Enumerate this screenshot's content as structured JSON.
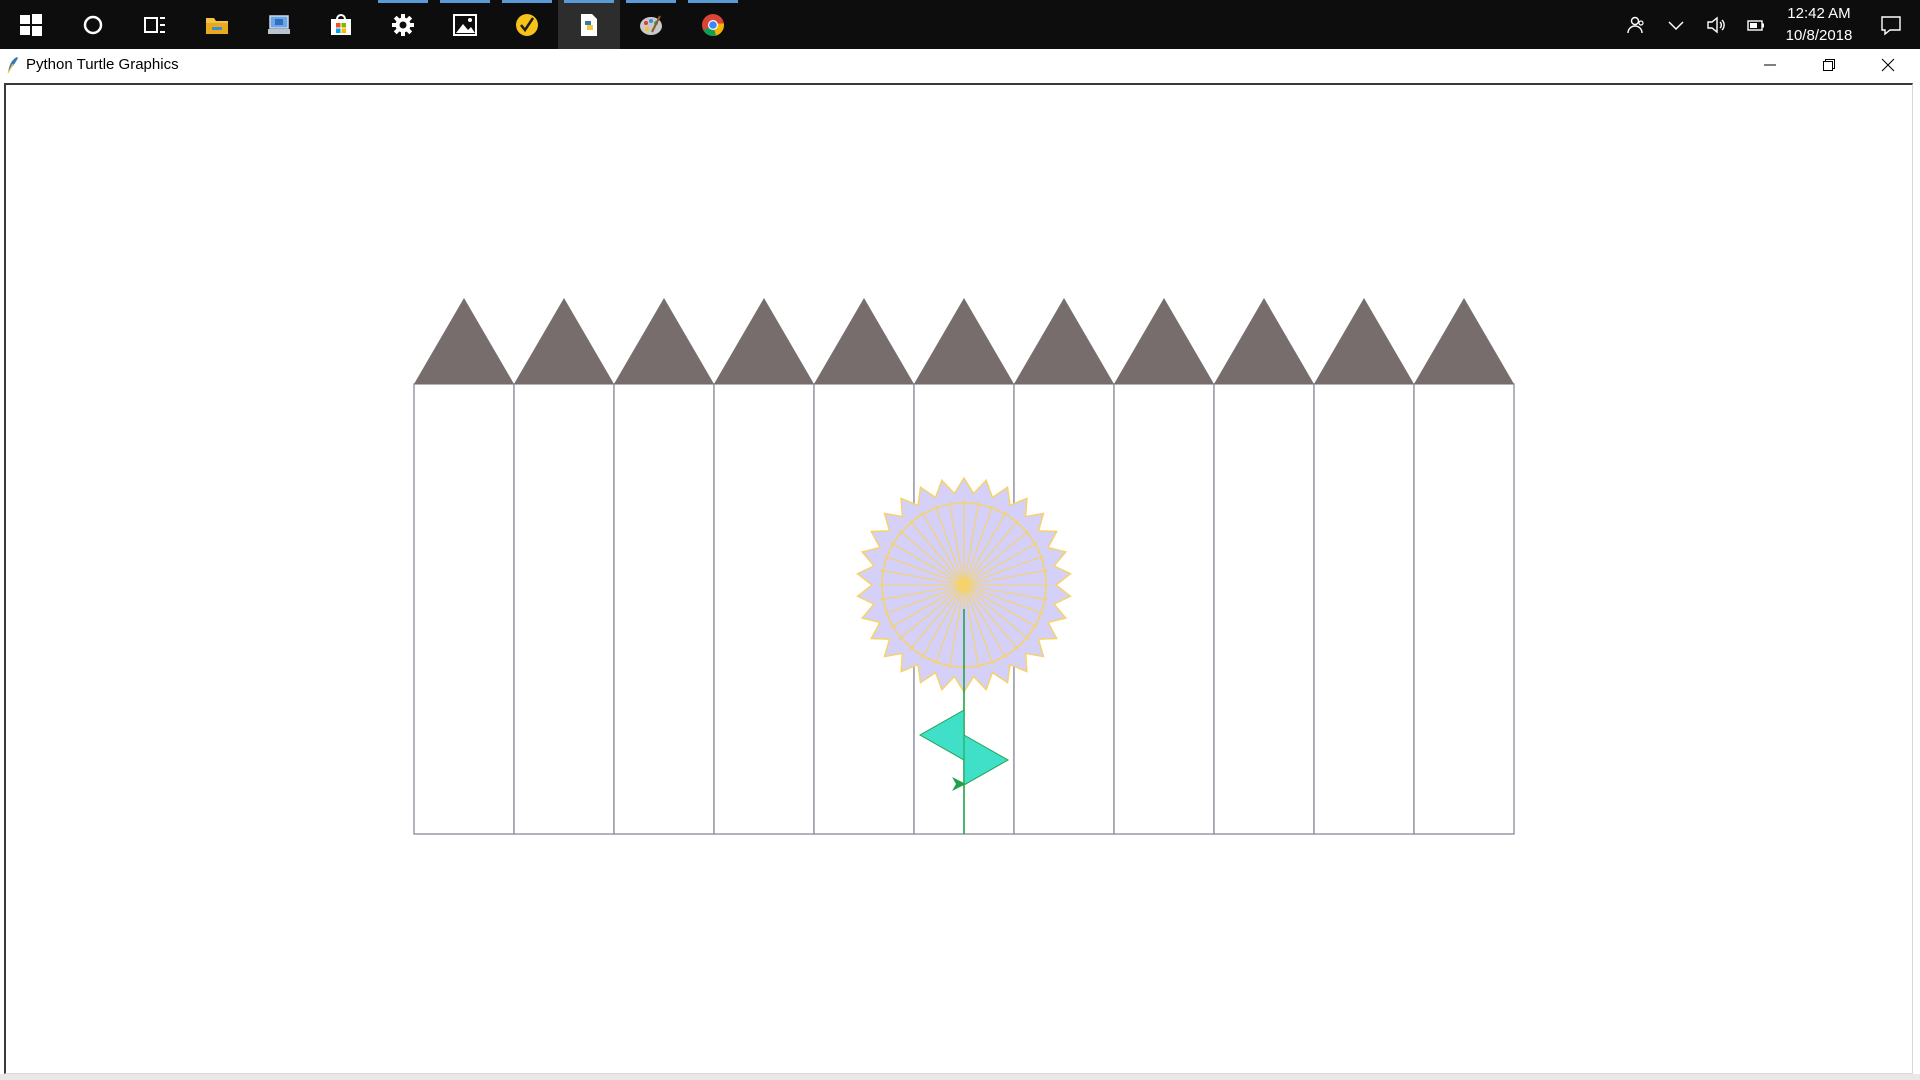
{
  "taskbar": {
    "buttons": [
      {
        "name": "start",
        "icon": "windows-logo-icon",
        "running": false
      },
      {
        "name": "cortana",
        "icon": "cortana-circle-icon",
        "running": false
      },
      {
        "name": "task-view",
        "icon": "task-view-icon",
        "running": false
      },
      {
        "name": "file-explorer",
        "icon": "folder-icon",
        "running": false
      },
      {
        "name": "computer",
        "icon": "computer-icon",
        "running": false
      },
      {
        "name": "store",
        "icon": "store-bag-icon",
        "running": false
      },
      {
        "name": "settings",
        "icon": "gear-icon",
        "running": true
      },
      {
        "name": "photos",
        "icon": "photos-icon",
        "running": true
      },
      {
        "name": "norton",
        "icon": "norton-check-icon",
        "running": true
      },
      {
        "name": "python",
        "icon": "python-file-icon",
        "running": true,
        "active": true
      },
      {
        "name": "paint",
        "icon": "paint-palette-icon",
        "running": true
      },
      {
        "name": "chrome",
        "icon": "chrome-icon",
        "running": true
      }
    ],
    "tray": {
      "icons": [
        "people-icon",
        "chevron-up-icon",
        "volume-icon",
        "battery-icon",
        "action-center-icon"
      ],
      "time": "12:42 AM",
      "date": "10/8/2018"
    }
  },
  "window": {
    "title": "Python Turtle Graphics",
    "icon": "python-feather-icon",
    "controls": [
      "minimize-icon",
      "restore-icon",
      "close-icon"
    ]
  },
  "drawing": {
    "fence": {
      "picket_count": 11,
      "post_color": "#ffffff",
      "post_outline": "#8a8a9a",
      "top_color": "#776d6d"
    },
    "flower": {
      "petal_color": "#d4d0f8",
      "petal_outline": "#f5d36a",
      "ray_color": "#f5d36a",
      "center_color": "#f5d36a",
      "stem_color": "#22a14a",
      "leaf_color": "#40e0c8",
      "leaf_outline": "#22a14a",
      "turtle_color": "#22a14a"
    },
    "colors": {
      "background": "#ffffff",
      "taskbar": "#0d0d0d",
      "taskbar_accent": "#5a9bd6"
    }
  }
}
